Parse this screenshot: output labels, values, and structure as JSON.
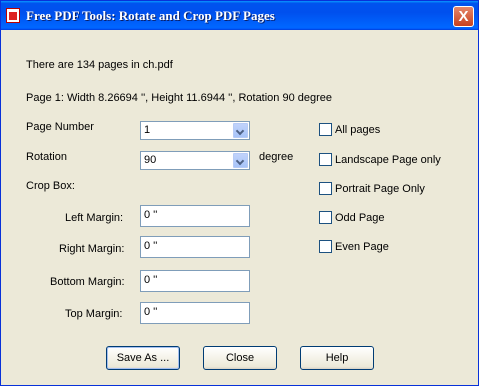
{
  "window": {
    "title": "Free PDF Tools: Rotate and Crop PDF Pages",
    "close_label": "X"
  },
  "info": {
    "pages_text": "There are 134 pages in ch.pdf",
    "page_info_text": "Page 1: Width 8.26694 '', Height 11.6944 '', Rotation 90 degree"
  },
  "form": {
    "page_number_label": "Page Number",
    "page_number_value": "1",
    "rotation_label": "Rotation",
    "rotation_value": "90",
    "rotation_unit": "degree",
    "crop_box_label": "Crop Box:",
    "left_margin_label": "Left Margin:",
    "left_margin_value": "0 ''",
    "right_margin_label": "Right Margin:",
    "right_margin_value": "0 ''",
    "bottom_margin_label": "Bottom Margin:",
    "bottom_margin_value": "0 ''",
    "top_margin_label": "Top Margin:",
    "top_margin_value": "0 ''"
  },
  "options": {
    "all_pages": "All pages",
    "landscape_only": "Landscape Page only",
    "portrait_only": "Portrait Page Only",
    "odd_page": "Odd Page",
    "even_page": "Even Page"
  },
  "buttons": {
    "save_as": "Save As ...",
    "close": "Close",
    "help": "Help"
  }
}
